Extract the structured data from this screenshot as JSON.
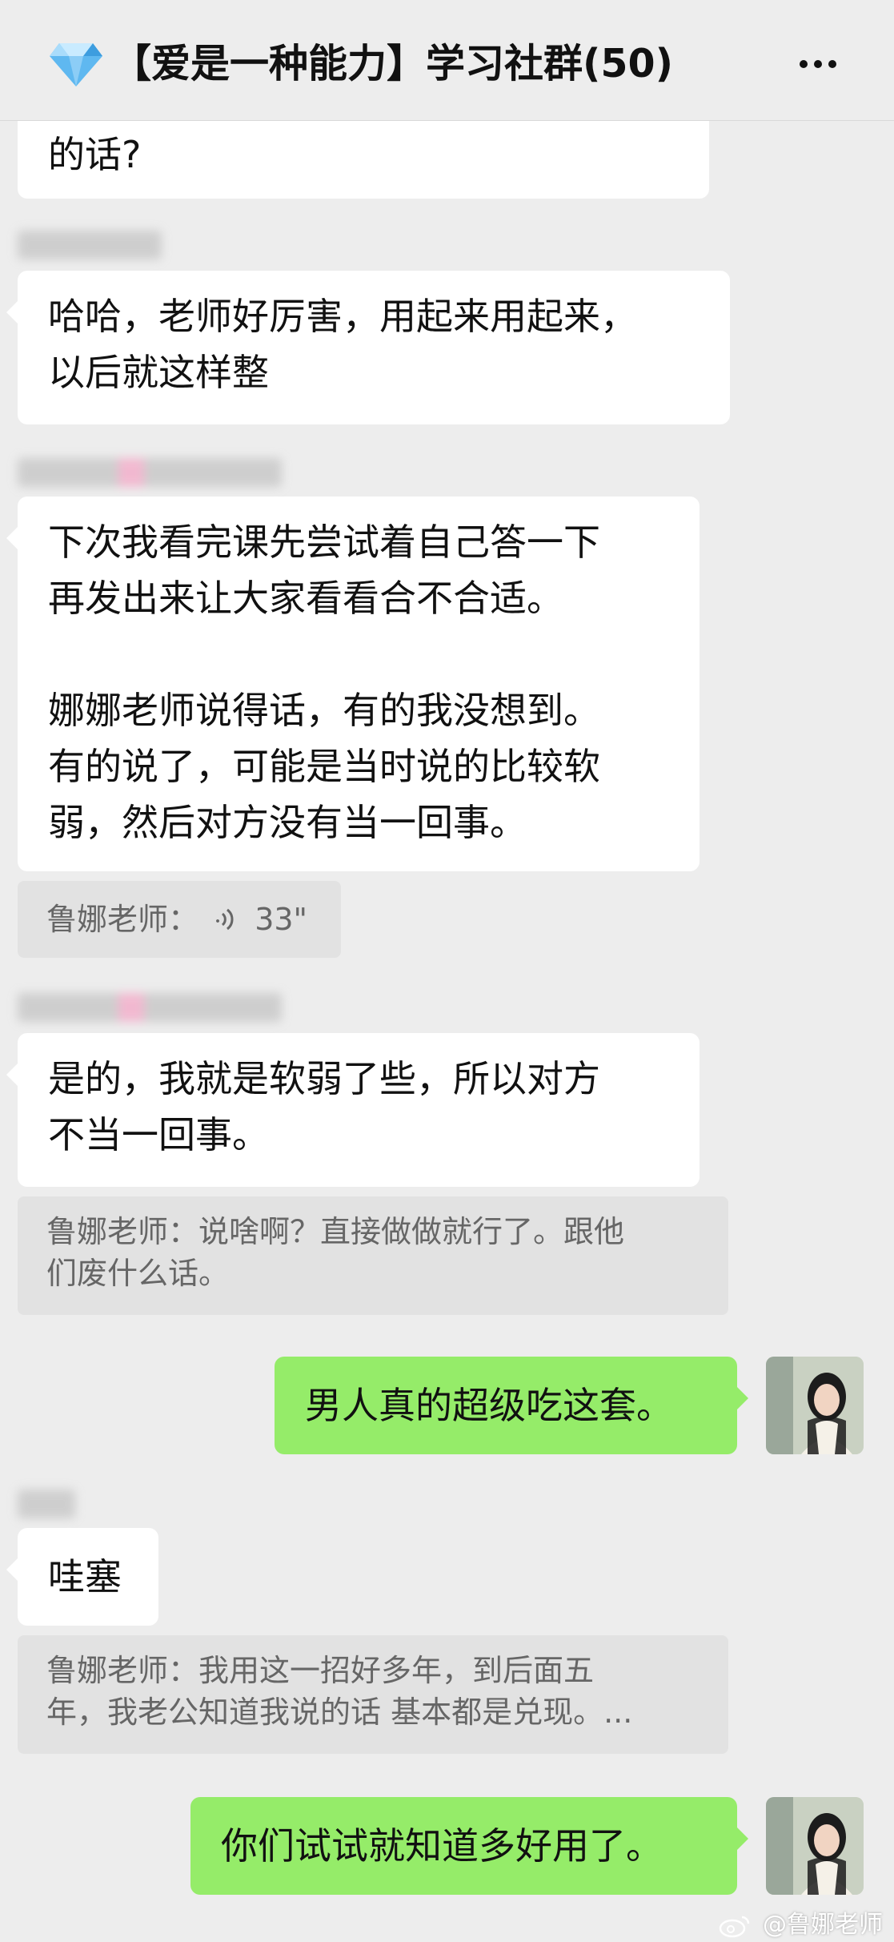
{
  "header": {
    "title": "【爱是一种能力】学习社群(50)",
    "more_icon": "more-dots-icon",
    "group_icon": "diamond-icon"
  },
  "messages": {
    "m0": {
      "lines": [
        "的话?"
      ]
    },
    "m1": {
      "lines": [
        "哈哈，老师好厉害，用起来用起来，",
        "以后就这样整"
      ]
    },
    "m2": {
      "para1": [
        "下次我看完课先尝试着自己答一下",
        "再发出来让大家看看合不合适。"
      ],
      "para2": [
        "娜娜老师说得话，有的我没想到。",
        "有的说了，可能是当时说的比较软",
        "弱，然后对方没有当一回事。"
      ]
    },
    "q1": {
      "text": "鲁娜老师：",
      "duration": "33\""
    },
    "m3": {
      "lines": [
        "是的，我就是软弱了些，所以对方",
        "不当一回事。"
      ]
    },
    "q2": {
      "lines": [
        "鲁娜老师：说啥啊？直接做做就行了。跟他",
        "们废什么话。"
      ]
    },
    "m4": {
      "text": "男人真的超级吃这套。"
    },
    "m5": {
      "text": "哇塞"
    },
    "q3": {
      "lines": [
        "鲁娜老师：我用这一招好多年，到后面五",
        "年，我老公知道我说的话 基本都是兑现。..."
      ]
    },
    "m6": {
      "text": "你们试试就知道多好用了。"
    }
  },
  "watermark": {
    "text": "@鲁娜老师"
  },
  "colors": {
    "background": "#ededed",
    "own_bubble": "#95ec69",
    "other_bubble": "#ffffff",
    "quote": "#e2e2e2"
  }
}
